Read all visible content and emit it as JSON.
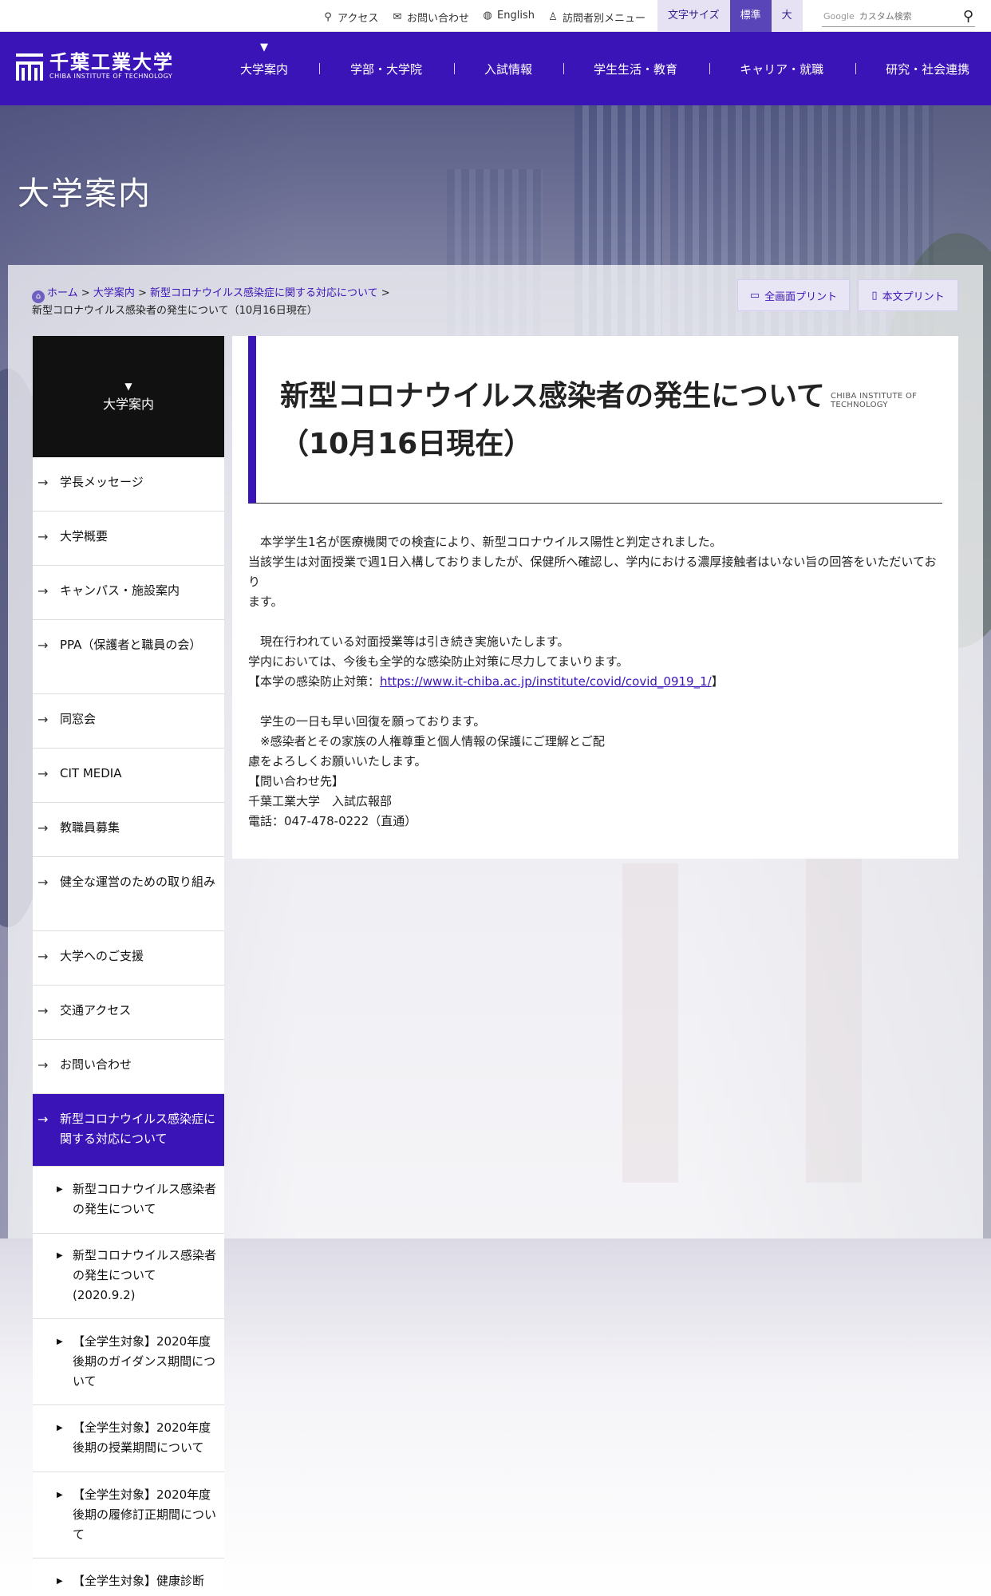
{
  "utility": {
    "access": "アクセス",
    "contact": "お問い合わせ",
    "english": "English",
    "visitor_menu": "訪問者別メニュー",
    "fontsize_label": "文字サイズ",
    "fontsize_standard": "標準",
    "fontsize_large": "大",
    "search_brand": "Google",
    "search_placeholder": "カスタム検索"
  },
  "header": {
    "logo_jp": "千葉工業大学",
    "logo_en": "CHIBA INSTITUTE OF TECHNOLOGY",
    "nav": [
      "大学案内",
      "学部・大学院",
      "入試情報",
      "学生生活・教育",
      "キャリア・就職",
      "研究・社会連携"
    ]
  },
  "hero": {
    "title": "大学案内"
  },
  "breadcrumb": {
    "home": "ホーム",
    "level1": "大学案内",
    "level2": "新型コロナウイルス感染症に関する対応について",
    "current": "新型コロナウイルス感染者の発生について（10月16日現在）",
    "sep": ">"
  },
  "print": {
    "full": "全画面プリント",
    "body": "本文プリント"
  },
  "sidebar": {
    "head": "大学案内",
    "items": [
      "学長メッセージ",
      "大学概要",
      "キャンパス・施設案内",
      "PPA（保護者と職員の会）",
      "同窓会",
      "CIT MEDIA",
      "教職員募集",
      "健全な運営のための取り組み",
      "大学へのご支援",
      "交通アクセス",
      "お問い合わせ"
    ],
    "active": "新型コロナウイルス感染症に関する対応について",
    "subitems": [
      "新型コロナウイルス感染者の発生について",
      "新型コロナウイルス感染者の発生について(2020.9.2)",
      "【全学生対象】2020年度後期のガイダンス期間について",
      "【全学生対象】2020年度後期の授業期間について",
      "【全学生対象】2020年度後期の履修訂正期間について",
      "【全学生対象】健康診断"
    ]
  },
  "article": {
    "title": "新型コロナウイルス感染者の発生について（10月16日現在）",
    "title_en": "CHIBA INSTITUTE OF TECHNOLOGY",
    "p1_line1": "本学学生1名が医療機関での検査により、新型コロナウイルス陽性と判定されました。",
    "p1_line2": "当該学生は対面授業で週1日入構しておりましたが、保健所へ確認し、学内における濃厚接触者はいない旨の回答をいただいており",
    "p1_line3": "ます。",
    "p2_line1": "現在行われている対面授業等は引き続き実施いたします。",
    "p2_line2": "学内においては、今後も全学的な感染防止対策に尽力してまいります。",
    "p2_line3_prefix": "【本学の感染防止対策：",
    "p2_link": "https://www.it-chiba.ac.jp/institute/covid/covid_0919_1/",
    "p2_line3_suffix": "】",
    "p3_line1": "学生の一日も早い回復を願っております。",
    "p3_line2": "※感染者とその家族の人権尊重と個人情報の保護にご理解とご配",
    "p3_line3": "慮をよろしくお願いいたします。",
    "contact_head": "【問い合わせ先】",
    "contact_org": "千葉工業大学　入試広報部",
    "contact_tel": "電話：047-478-0222（直通）"
  }
}
